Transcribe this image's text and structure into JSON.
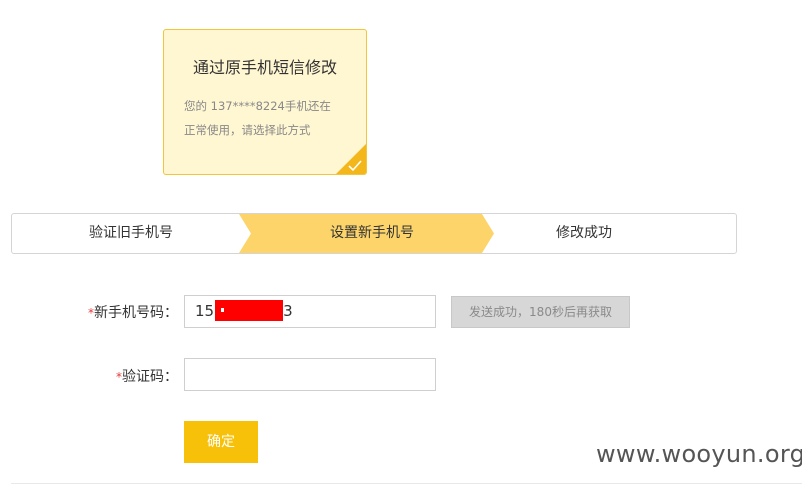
{
  "option_card": {
    "title": "通过原手机短信修改",
    "desc_line1": "您的 137****8224手机还在",
    "desc_line2": "正常使用，请选择此方式",
    "selected_icon": "check-icon"
  },
  "steps": [
    {
      "label": "验证旧手机号",
      "active": false
    },
    {
      "label": "设置新手机号",
      "active": true
    },
    {
      "label": "修改成功",
      "active": false
    }
  ],
  "form": {
    "phone_label": "新手机号码：",
    "phone_value_prefix": "15",
    "phone_value_suffix": "3",
    "send_button": "发送成功，180秒后再获取",
    "code_label": "验证码：",
    "code_value": "",
    "required_mark": "*",
    "submit": "确定"
  },
  "watermark": "www.wooyun.org",
  "colors": {
    "accent": "#f7c10a",
    "step_active": "#fdd46a",
    "card_bg": "#fff6d2",
    "card_border": "#f3c53a",
    "redaction": "#ff0000"
  }
}
